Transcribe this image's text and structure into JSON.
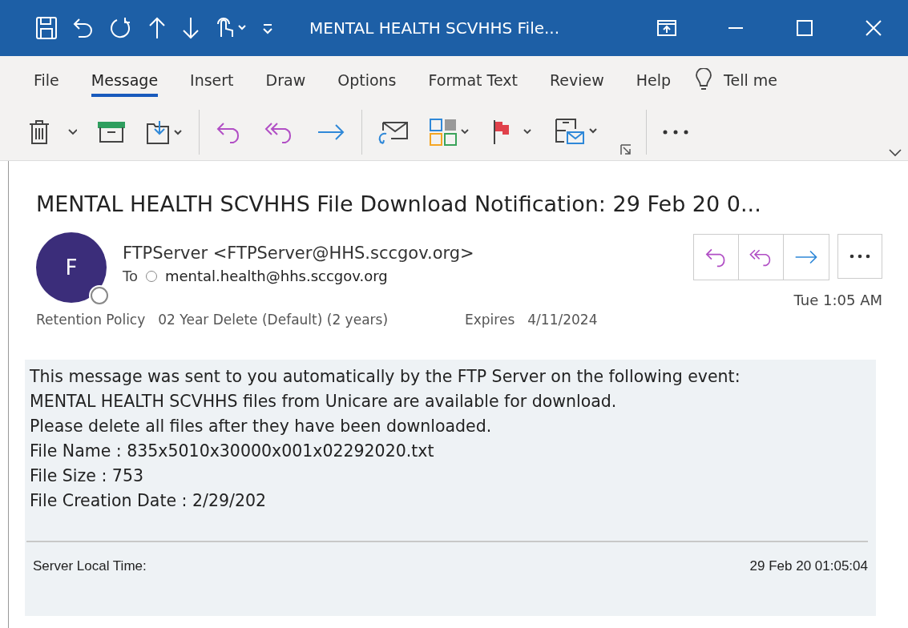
{
  "window": {
    "title": "MENTAL HEALTH SCVHHS File..."
  },
  "tabs": [
    {
      "label": "File",
      "selected": false
    },
    {
      "label": "Message",
      "selected": true
    },
    {
      "label": "Insert",
      "selected": false
    },
    {
      "label": "Draw",
      "selected": false
    },
    {
      "label": "Options",
      "selected": false
    },
    {
      "label": "Format Text",
      "selected": false
    },
    {
      "label": "Review",
      "selected": false
    },
    {
      "label": "Help",
      "selected": false
    }
  ],
  "tell_me": "Tell me",
  "message": {
    "subject": "MENTAL HEALTH SCVHHS File Download Notification: 29 Feb 20 0...",
    "avatar_initial": "F",
    "sender": "FTPServer <FTPServer@HHS.sccgov.org>",
    "to_label": "To",
    "recipient": "mental.health@hhs.sccgov.org",
    "time": "Tue 1:05 AM",
    "retention_label": "Retention Policy",
    "retention_value": "02 Year Delete (Default) (2 years)",
    "expires_label": "Expires",
    "expires_value": "4/11/2024"
  },
  "body": {
    "lines": [
      "This message was sent to you automatically by the FTP Server on the following event:",
      "MENTAL HEALTH SCVHHS files from Unicare are available for download.",
      "Please delete all files after they have been downloaded.",
      "File Name : 835x5010x30000x001x02292020.txt",
      "File Size : 753",
      "File Creation Date : 2/29/202"
    ],
    "footer_label": "Server Local Time:",
    "footer_value": "29 Feb 20 01:05:04"
  }
}
